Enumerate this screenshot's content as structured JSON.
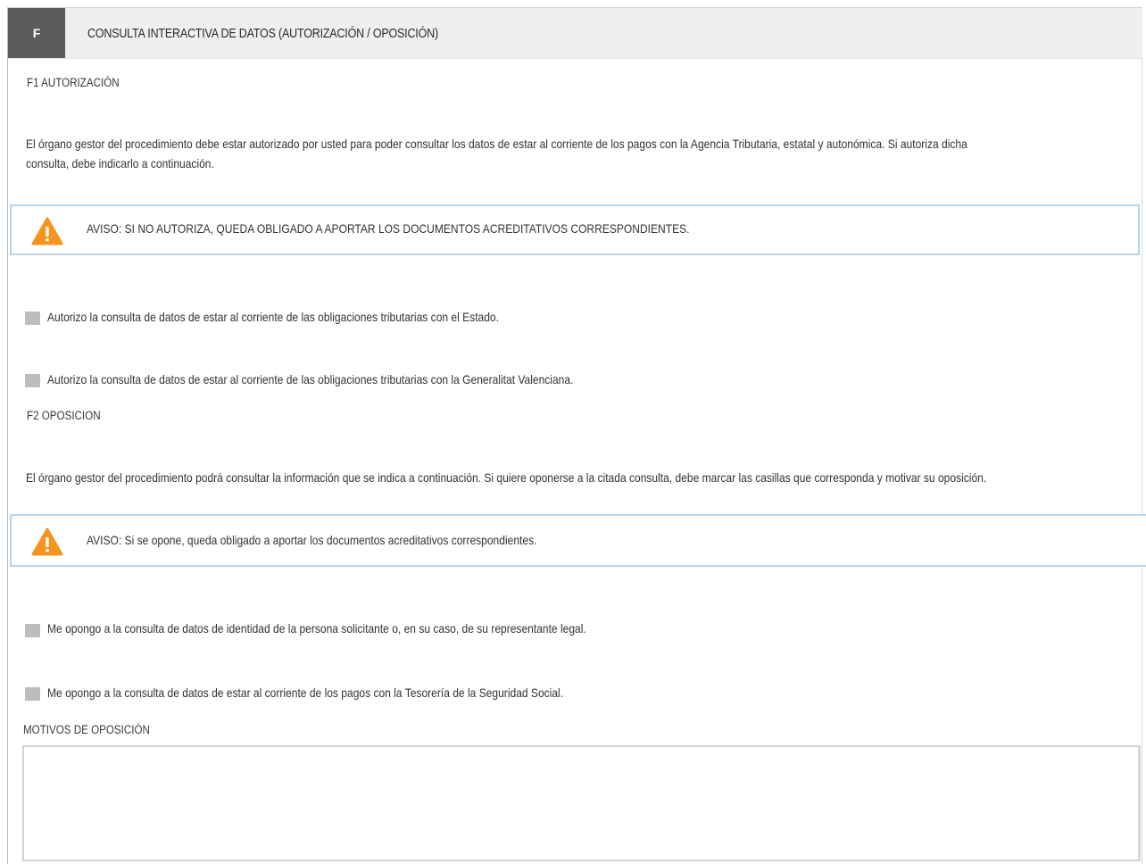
{
  "section": {
    "letter": "F",
    "title": "CONSULTA INTERACTIVA DE DATOS (AUTORIZACIÓN / OPOSICIÓN)"
  },
  "f1": {
    "heading": "F1 AUTORIZACIÓN",
    "paragraph_line1": "El órgano gestor del procedimiento debe estar autorizado por usted para poder consultar los datos de estar al corriente de los pagos con la Agencia Tributaria, estatal y autonómica. Si autoriza dicha",
    "paragraph_line2": "consulta, debe indicarlo a continuación.",
    "notice": "AVISO: SI NO AUTORIZA, QUEDA OBLIGADO A APORTAR LOS DOCUMENTOS ACREDITATIVOS CORRESPONDIENTES.",
    "checkboxes": [
      {
        "label": "Autorizo la consulta de datos de estar al corriente de las obligaciones tributarias con el Estado.",
        "checked": false
      },
      {
        "label": "Autorizo la consulta de datos de estar al corriente de las obligaciones tributarias con la Generalitat Valenciana.",
        "checked": false
      }
    ]
  },
  "f2": {
    "heading": "F2 OPOSICION",
    "paragraph": "El órgano gestor del procedimiento podrá consultar la información que se indica a continuación. Si quiere oponerse a la citada consulta, debe marcar las casillas que corresponda y motivar su oposición.",
    "notice": "AVISO: Si se opone, queda obligado a aportar los documentos acreditativos correspondientes.",
    "checkboxes": [
      {
        "label": "Me opongo a la consulta de datos de identidad de la persona solicitante o, en su caso, de su representante legal.",
        "checked": false
      },
      {
        "label": "Me opongo a la consulta de datos de estar al corriente de los pagos con la Tesorería de la Seguridad Social.",
        "checked": false
      }
    ],
    "motivos_label": "MOTIVOS DE OPOSICIÓN",
    "motivos_value": ""
  },
  "colors": {
    "header_bg": "#efefef",
    "letter_bg": "#5b5b5b",
    "notice_border": "#b8d4ea",
    "warning_icon": "#f7941d",
    "checkbox": "#bdbdbd"
  },
  "icons": {
    "warning": "warning-triangle-icon"
  }
}
